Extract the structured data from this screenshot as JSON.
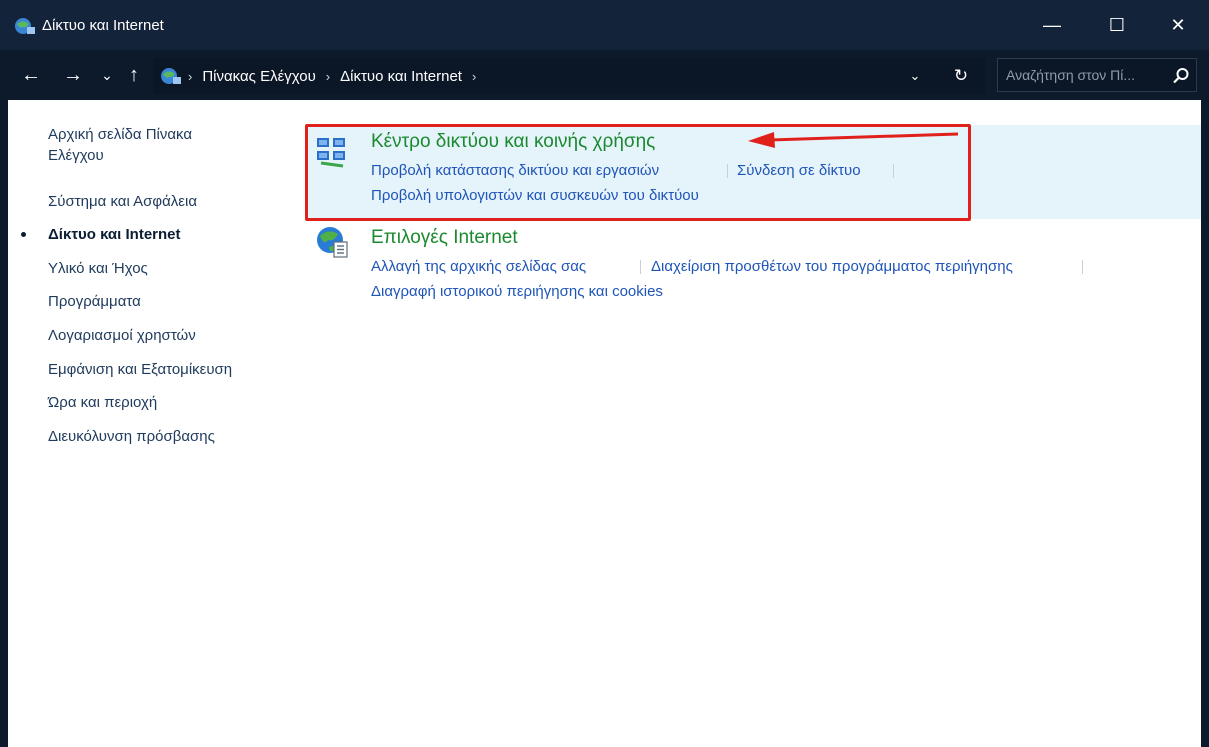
{
  "window": {
    "title": "Δίκτυο και Internet",
    "controls": {
      "minimize": "—",
      "maximize": "☐",
      "close": "✕"
    }
  },
  "address_bar": {
    "breadcrumbs": [
      "Πίνακας Ελέγχου",
      "Δίκτυο και Internet"
    ],
    "search_placeholder": "Αναζήτηση στον Πί..."
  },
  "sidebar": {
    "items": [
      {
        "label": "Αρχική σελίδα Πίνακα",
        "label2": "Ελέγχου"
      },
      {
        "label": "Σύστημα και Ασφάλεια"
      },
      {
        "label": "Δίκτυο και Internet",
        "active": true
      },
      {
        "label": "Υλικό και Ήχος"
      },
      {
        "label": "Προγράμματα"
      },
      {
        "label": "Λογαριασμοί χρηστών"
      },
      {
        "label": "Εμφάνιση και Εξατομίκευση"
      },
      {
        "label": "Ώρα και περιοχή"
      },
      {
        "label": "Διευκόλυνση πρόσβασης"
      }
    ]
  },
  "categories": [
    {
      "title": "Κέντρο δικτύου και κοινής χρήσης",
      "icon": "network-center-icon",
      "links": [
        "Προβολή κατάστασης δικτύου και εργασιών",
        "Σύνδεση σε δίκτυο",
        "Προβολή υπολογιστών και συσκευών του δικτύου"
      ],
      "highlighted": true
    },
    {
      "title": "Επιλογές Internet",
      "icon": "internet-options-icon",
      "links": [
        "Αλλαγή της αρχικής σελίδας σας",
        "Διαχείριση προσθέτων του προγράμματος περιήγησης",
        "Διαγραφή ιστορικού περιήγησης και cookies"
      ]
    }
  ],
  "colors": {
    "title_bar": "#13233a",
    "category_title": "#1b8a2f",
    "link": "#1f55b8",
    "highlight": "#e0201b",
    "hover_row": "#e5f3fb"
  }
}
